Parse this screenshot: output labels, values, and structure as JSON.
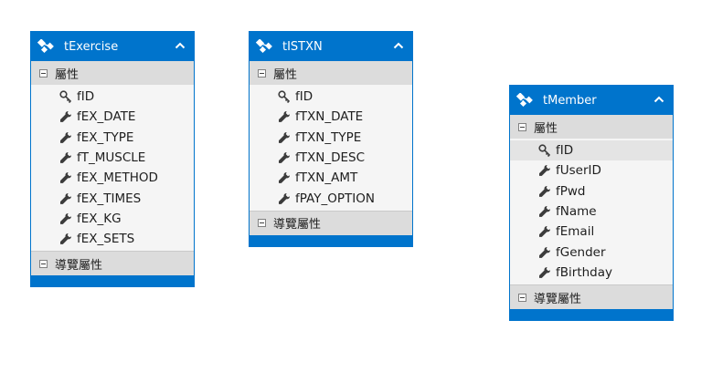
{
  "entities": [
    {
      "name": "tExercise",
      "properties_label": "屬性",
      "nav_label": "導覽屬性",
      "properties": [
        {
          "name": "fID",
          "key": true
        },
        {
          "name": "fEX_DATE",
          "key": false
        },
        {
          "name": "fEX_TYPE",
          "key": false
        },
        {
          "name": "fT_MUSCLE",
          "key": false
        },
        {
          "name": "fEX_METHOD",
          "key": false
        },
        {
          "name": "fEX_TIMES",
          "key": false
        },
        {
          "name": "fEX_KG",
          "key": false
        },
        {
          "name": "fEX_SETS",
          "key": false
        }
      ]
    },
    {
      "name": "tISTXN",
      "properties_label": "屬性",
      "nav_label": "導覽屬性",
      "properties": [
        {
          "name": "fID",
          "key": true
        },
        {
          "name": "fTXN_DATE",
          "key": false
        },
        {
          "name": "fTXN_TYPE",
          "key": false
        },
        {
          "name": "fTXN_DESC",
          "key": false
        },
        {
          "name": "fTXN_AMT",
          "key": false
        },
        {
          "name": "fPAY_OPTION",
          "key": false
        }
      ]
    },
    {
      "name": "tMember",
      "properties_label": "屬性",
      "nav_label": "導覽屬性",
      "properties": [
        {
          "name": "fID",
          "key": true,
          "selected": true
        },
        {
          "name": "fUserID",
          "key": false
        },
        {
          "name": "fPwd",
          "key": false
        },
        {
          "name": "fName",
          "key": false
        },
        {
          "name": "fEmail",
          "key": false
        },
        {
          "name": "fGender",
          "key": false
        },
        {
          "name": "fBirthday",
          "key": false
        }
      ]
    }
  ],
  "colors": {
    "header": "#0074cc",
    "section": "#dcdcdc",
    "body": "#f5f5f5"
  },
  "icons": {
    "entity": "entity-icon",
    "collapse": "chevron-up-icon",
    "key": "key-icon",
    "property": "wrench-icon",
    "toggle": "collapse-toggle-icon"
  }
}
